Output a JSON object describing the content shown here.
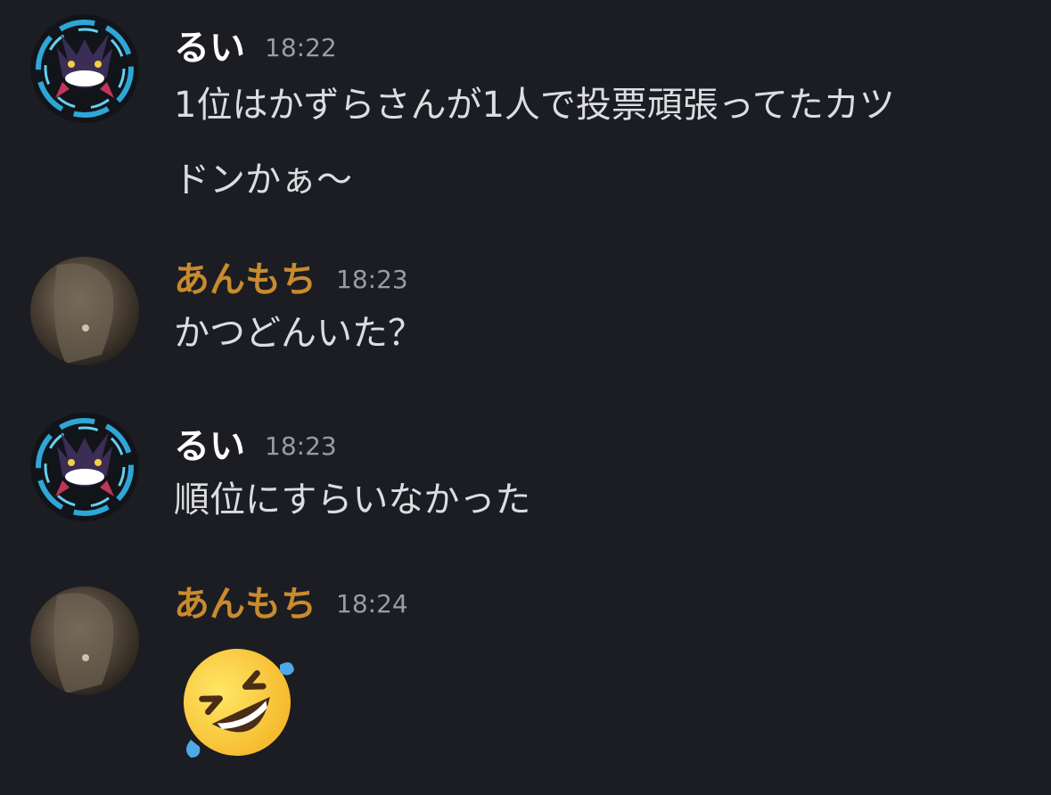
{
  "messages": [
    {
      "author": "るい",
      "time": "18:22",
      "text_line1": "1位はかずらさんが1人で投票頑張ってたカツ",
      "text_line2": "ドンかぁ〜",
      "avatar": "gengar-avatar"
    },
    {
      "author": "あんもち",
      "time": "18:23",
      "text": "かつどんいた？",
      "avatar": "photo-avatar"
    },
    {
      "author": "るい",
      "time": "18:23",
      "text": "順位にすらいなかった",
      "avatar": "gengar-avatar"
    },
    {
      "author": "あんもち",
      "time": "18:24",
      "emoji": "rolling-on-the-floor-laughing-emoji",
      "avatar": "photo-avatar"
    }
  ],
  "colors": {
    "background": "#1c1d22",
    "name_rui": "#ffffff",
    "name_anmochi": "#c98b2e",
    "timestamp": "#9a9ca3",
    "message_text": "#dcdde1"
  }
}
